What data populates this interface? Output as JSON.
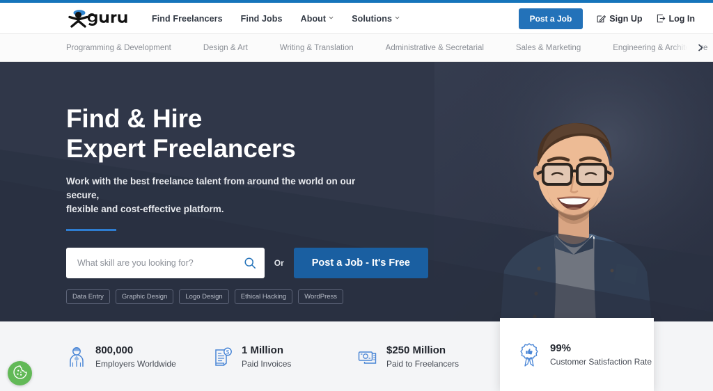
{
  "header": {
    "logo_text": "guru",
    "logo_icon": "guru-stickman-logo",
    "nav": [
      {
        "label": "Find Freelancers",
        "has_dropdown": false
      },
      {
        "label": "Find Jobs",
        "has_dropdown": false
      },
      {
        "label": "About",
        "has_dropdown": true
      },
      {
        "label": "Solutions",
        "has_dropdown": true
      }
    ],
    "post_job_label": "Post a Job",
    "sign_up_label": "Sign Up",
    "sign_up_icon": "pencil-square-icon",
    "log_in_label": "Log In",
    "log_in_icon": "login-arrow-icon",
    "accent_color": "#2372b9"
  },
  "categories": {
    "items": [
      "Programming & Development",
      "Design & Art",
      "Writing & Translation",
      "Administrative & Secretarial",
      "Sales & Marketing",
      "Engineering & Architecture"
    ],
    "next_icon": "chevron-right-icon"
  },
  "hero": {
    "title_line1": "Find & Hire",
    "title_line2": "Expert Freelancers",
    "subtitle_line1": "Work with the best freelance talent from around the world on our secure,",
    "subtitle_line2": "flexible and cost-effective platform.",
    "search_placeholder": "What skill are you looking for?",
    "search_value": "",
    "search_icon": "search-icon",
    "or_label": "Or",
    "cta_label": "Post a Job - It's Free",
    "chips": [
      "Data Entry",
      "Graphic Design",
      "Logo Design",
      "Ethical Hacking",
      "WordPress"
    ],
    "background_color": "#303749",
    "accent_color": "#2e7dd1",
    "photo_alt": "smiling-man-with-glasses-in-denim-shirt"
  },
  "stats": {
    "items": [
      {
        "value": "800,000",
        "label": "Employers Worldwide",
        "icon": "employer-person-icon"
      },
      {
        "value": "1 Million",
        "label": "Paid Invoices",
        "icon": "invoice-dollar-icon"
      },
      {
        "value": "$250 Million",
        "label": "Paid to Freelancers",
        "icon": "cash-money-icon"
      }
    ],
    "card": {
      "value": "99%",
      "label": "Customer Satisfaction Rate",
      "icon": "award-ribbon-thumbsup-icon"
    },
    "icon_color": "#4a86d6",
    "background_color": "#f4f5f7"
  },
  "cookie_widget": {
    "icon": "cookie-icon",
    "color": "#62b957"
  }
}
